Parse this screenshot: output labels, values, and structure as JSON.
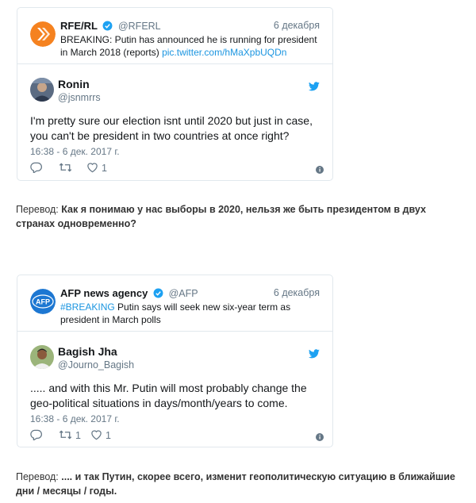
{
  "tweets": [
    {
      "quoted": {
        "name": "RFE/RL",
        "handle": "@RFERL",
        "date": "6 декабря",
        "text": "BREAKING: Putin has announced he is running for president in March 2018 (reports) ",
        "link": "pic.twitter.com/hMaXpbUQDn",
        "avatar_color": "#f58220"
      },
      "author": {
        "name": "Ronin",
        "handle": "@jsnmrrs"
      },
      "text": "I'm pretty sure our election isnt until 2020 but just in case, you can't be president in two countries at once right?",
      "time": "16:38 - 6 дек. 2017 г.",
      "retweets": "",
      "likes": "1"
    },
    {
      "quoted": {
        "name": "AFP news agency",
        "handle": "@AFP",
        "date": "6 декабря",
        "hashtag": "#BREAKING",
        "text": " Putin says will seek new six-year term as president in March polls",
        "avatar_color": "#1d77d2"
      },
      "author": {
        "name": "Bagish Jha",
        "handle": "@Journo_Bagish"
      },
      "text": "..... and with this Mr. Putin will most probably change the geo-political situations in days/month/years to come.",
      "time": "16:38 - 6 дек. 2017 г.",
      "retweets": "1",
      "likes": "1"
    }
  ],
  "translations": [
    {
      "label": "Перевод: ",
      "text": "Как я понимаю у нас выборы в 2020, нельзя же быть президентом в двух странах одновременно?"
    },
    {
      "label": "Перевод: ",
      "text": ".... и так Путин, скорее всего, изменит геополитическую ситуацию в ближайшие дни / месяцы / годы."
    }
  ],
  "icons": {
    "verified": "verified-badge-icon",
    "twitter": "twitter-bird-icon",
    "reply": "reply-icon",
    "retweet": "retweet-icon",
    "like": "heart-icon",
    "info": "info-icon"
  },
  "colors": {
    "link": "#1b95e0",
    "verified": "#1da1f2",
    "muted": "#657786",
    "border": "#e1e8ed"
  }
}
